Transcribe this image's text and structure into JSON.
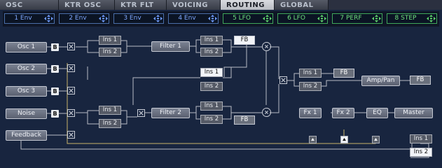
{
  "tabs": [
    {
      "label": "OSC"
    },
    {
      "label": "KTR OSC"
    },
    {
      "label": "KTR FLT"
    },
    {
      "label": "VOICING"
    },
    {
      "label": "ROUTING"
    },
    {
      "label": "GLOBAL"
    }
  ],
  "active_tab": "ROUTING",
  "mod_sources": [
    {
      "label": "1 Env"
    },
    {
      "label": "2 Env"
    },
    {
      "label": "3 Env"
    },
    {
      "label": "4 Env"
    },
    {
      "label": "5 LFO"
    },
    {
      "label": "6 LFO"
    },
    {
      "label": "7 PERF"
    },
    {
      "label": "8 STEP"
    }
  ],
  "sources": [
    {
      "label": "Osc 1"
    },
    {
      "label": "Osc 2"
    },
    {
      "label": "Osc 3"
    },
    {
      "label": "Noise"
    },
    {
      "label": "Feedback"
    }
  ],
  "b_label": "B",
  "filter1": {
    "label": "Filter 1"
  },
  "filter2": {
    "label": "Filter 2"
  },
  "ins1": "Ins 1",
  "ins2": "Ins 2",
  "fb": "FB",
  "amp": "Amp/Pan",
  "fx1": "Fx 1",
  "fx2": "Fx 2",
  "eq": "EQ",
  "master": "Master"
}
